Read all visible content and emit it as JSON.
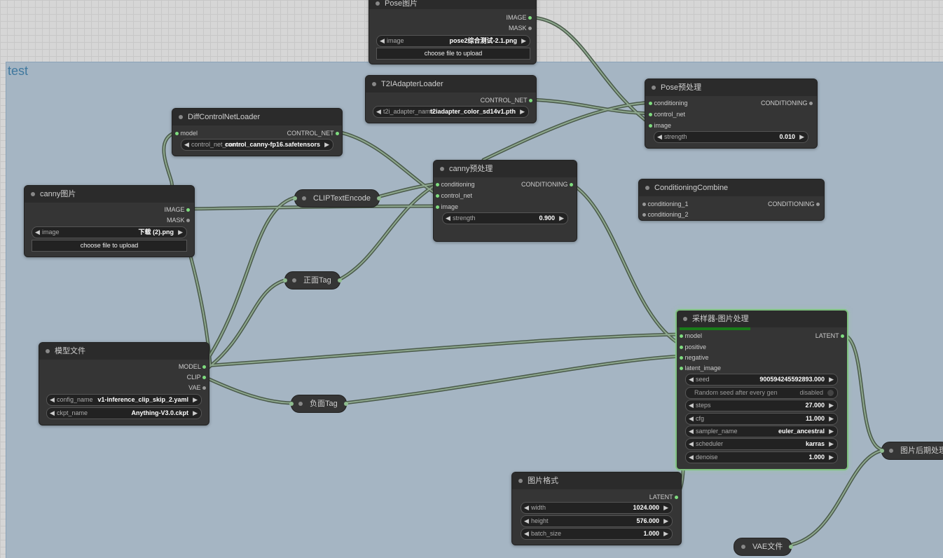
{
  "group": {
    "title": "test"
  },
  "nodes": {
    "pose_image": {
      "title": "Pose图片",
      "out_image": "IMAGE",
      "out_mask": "MASK",
      "image_label": "image",
      "image_value": "pose2综合测试-2.1.png",
      "upload": "choose file to upload"
    },
    "t2i_loader": {
      "title": "T2IAdapterLoader",
      "out": "CONTROL_NET",
      "name_label": "t2i_adapter_name",
      "name_value": "t2iadapter_color_sd14v1.pth"
    },
    "pose_pre": {
      "title": "Pose预处理",
      "in1": "conditioning",
      "in2": "control_net",
      "in3": "image",
      "out": "CONDITIONING",
      "strength_label": "strength",
      "strength_value": "0.010"
    },
    "diff_loader": {
      "title": "DiffControlNetLoader",
      "in": "model",
      "out": "CONTROL_NET",
      "name_label": "control_net_name",
      "name_value": "control_canny-fp16.safetensors"
    },
    "canny_pre": {
      "title": "canny预处理",
      "in1": "conditioning",
      "in2": "control_net",
      "in3": "image",
      "out": "CONDITIONING",
      "strength_label": "strength",
      "strength_value": "0.900"
    },
    "cond_combine": {
      "title": "ConditioningCombine",
      "in1": "conditioning_1",
      "in2": "conditioning_2",
      "out": "CONDITIONING"
    },
    "canny_image": {
      "title": "canny图片",
      "out_image": "IMAGE",
      "out_mask": "MASK",
      "image_label": "image",
      "image_value": "下载 (2).png",
      "upload": "choose file to upload"
    },
    "clip_text": {
      "title": "CLIPTextEncode"
    },
    "pos_tag": {
      "title": "正面Tag"
    },
    "neg_tag": {
      "title": "负面Tag"
    },
    "model_file": {
      "title": "模型文件",
      "out_model": "MODEL",
      "out_clip": "CLIP",
      "out_vae": "VAE",
      "config_label": "config_name",
      "config_value": "v1-inference_clip_skip_2.yaml",
      "ckpt_label": "ckpt_name",
      "ckpt_value": "Anything-V3.0.ckpt"
    },
    "sampler": {
      "title": "采样器-图片处理",
      "in_model": "model",
      "in_pos": "positive",
      "in_neg": "negative",
      "in_latent": "latent_image",
      "out": "LATENT",
      "seed_label": "seed",
      "seed_value": "900594245592893.000",
      "random_label": "Random seed after every gen",
      "random_value": "disabled",
      "steps_label": "steps",
      "steps_value": "27.000",
      "cfg_label": "cfg",
      "cfg_value": "11.000",
      "sampler_label": "sampler_name",
      "sampler_value": "euler_ancestral",
      "scheduler_label": "scheduler",
      "scheduler_value": "karras",
      "denoise_label": "denoise",
      "denoise_value": "1.000",
      "progress": 0.43
    },
    "img_format": {
      "title": "图片格式",
      "out": "LATENT",
      "width_label": "width",
      "width_value": "1024.000",
      "height_label": "height",
      "height_value": "576.000",
      "batch_label": "batch_size",
      "batch_value": "1.000"
    },
    "post": {
      "title": "图片后期处理"
    },
    "vae_file": {
      "title": "VAE文件"
    }
  },
  "colors": {
    "wire": "#6e8c6e",
    "socket_active": "#7fdc7f",
    "group_title": "#3f789e"
  }
}
